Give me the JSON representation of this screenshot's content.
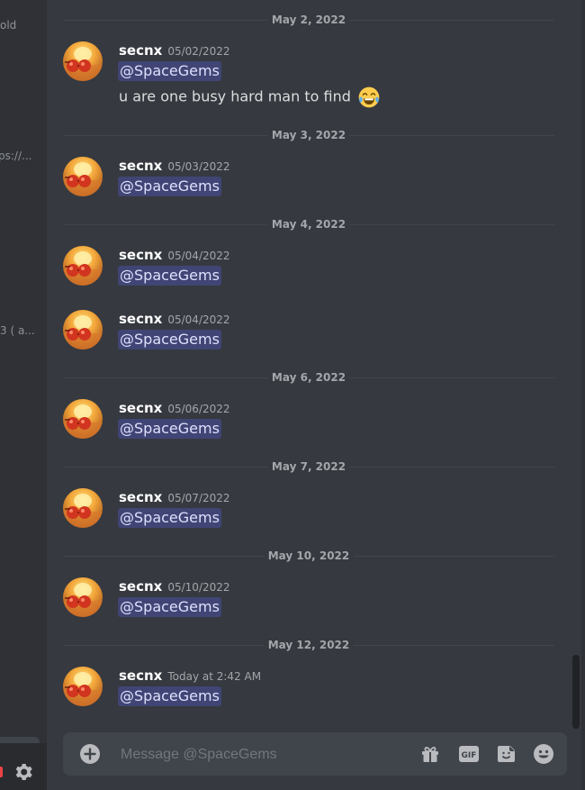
{
  "sidebar": {
    "fragments": [
      "old",
      "ps://...",
      "3 ( a..."
    ]
  },
  "messages_meta": {
    "author": "secnx",
    "mention": "@SpaceGems"
  },
  "timeline": [
    {
      "divider": "May 2, 2022",
      "messages": [
        {
          "author": "secnx",
          "timestamp": "05/02/2022",
          "mention": "@SpaceGems",
          "text": "u are one busy hard man to find",
          "emoji": "joy-emoji"
        }
      ]
    },
    {
      "divider": "May 3, 2022",
      "messages": [
        {
          "author": "secnx",
          "timestamp": "05/03/2022",
          "mention": "@SpaceGems"
        }
      ]
    },
    {
      "divider": "May 4, 2022",
      "messages": [
        {
          "author": "secnx",
          "timestamp": "05/04/2022",
          "mention": "@SpaceGems"
        },
        {
          "author": "secnx",
          "timestamp": "05/04/2022",
          "mention": "@SpaceGems"
        }
      ]
    },
    {
      "divider": "May 6, 2022",
      "messages": [
        {
          "author": "secnx",
          "timestamp": "05/06/2022",
          "mention": "@SpaceGems"
        }
      ]
    },
    {
      "divider": "May 7, 2022",
      "messages": [
        {
          "author": "secnx",
          "timestamp": "05/07/2022",
          "mention": "@SpaceGems"
        }
      ]
    },
    {
      "divider": "May 10, 2022",
      "messages": [
        {
          "author": "secnx",
          "timestamp": "05/10/2022",
          "mention": "@SpaceGems"
        }
      ]
    },
    {
      "divider": "May 12, 2022",
      "messages": [
        {
          "author": "secnx",
          "timestamp": "Today at 2:42 AM",
          "mention": "@SpaceGems"
        }
      ]
    }
  ],
  "composer": {
    "placeholder": "Message @SpaceGems",
    "icons": [
      "add-attachment-icon",
      "gift-icon",
      "gif-icon",
      "sticker-icon",
      "emoji-icon"
    ],
    "gif_label": "GIF"
  },
  "colors": {
    "background": "#36393f",
    "mention_bg": "#3c4270",
    "mention_text": "#dee0fc"
  }
}
